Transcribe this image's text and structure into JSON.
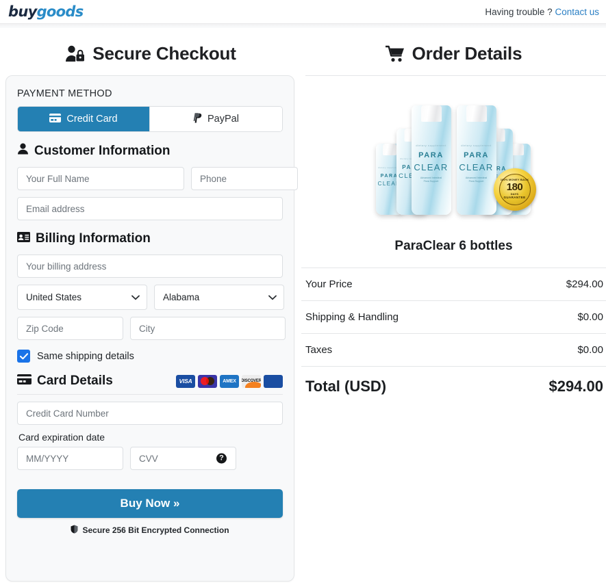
{
  "header": {
    "logo_buy": "buy",
    "logo_goods": "goods",
    "help_text": "Having trouble ?",
    "help_link": "Contact us"
  },
  "left": {
    "title": "Secure Checkout",
    "payment_method_label": "PAYMENT METHOD",
    "tabs": [
      {
        "label": "Credit Card",
        "icon": "credit-card-icon",
        "active": true
      },
      {
        "label": "PayPal",
        "icon": "paypal-icon",
        "active": false
      }
    ],
    "customer": {
      "heading": "Customer Information",
      "full_name_placeholder": "Your Full Name",
      "full_name_value": "",
      "phone_placeholder": "Phone",
      "phone_value": "",
      "email_placeholder": "Email address",
      "email_value": ""
    },
    "billing": {
      "heading": "Billing Information",
      "address_placeholder": "Your billing address",
      "address_value": "",
      "country_selected": "United States",
      "state_selected": "Alabama",
      "zip_placeholder": "Zip Code",
      "zip_value": "",
      "city_placeholder": "City",
      "city_value": "",
      "same_shipping_label": "Same shipping details",
      "same_shipping_checked": true
    },
    "card": {
      "heading": "Card Details",
      "logos": [
        "VISA",
        "Mastercard",
        "AMEX",
        "DISCOVER",
        "JCB"
      ],
      "number_placeholder": "Credit Card Number",
      "number_value": "",
      "expiration_label": "Card expiration date",
      "expiration_placeholder": "MM/YYYY",
      "expiration_value": "",
      "cvv_placeholder": "CVV",
      "cvv_value": "",
      "cvv_help_icon": "question-mark-icon"
    },
    "buy_button": "Buy Now »",
    "secure_note": "Secure 256 Bit Encrypted Connection"
  },
  "right": {
    "title": "Order Details",
    "product_name": "ParaClear 6 bottles",
    "product_label_brand_top": "dietary supplement",
    "product_label_line1": "PARA",
    "product_label_line2": "CLEAR",
    "product_label_sub": "Advanced Intestinal\nFlora Support",
    "badge": {
      "top_text": "100% MONEY BACK",
      "number": "180",
      "days": "DAYS",
      "bottom_text": "GUARANTEE"
    },
    "summary": [
      {
        "label": "Your Price",
        "value": "$294.00"
      },
      {
        "label": "Shipping & Handling",
        "value": "$0.00"
      },
      {
        "label": "Taxes",
        "value": "$0.00"
      }
    ],
    "total": {
      "label": "Total (USD)",
      "value": "$294.00"
    }
  },
  "colors": {
    "accent_blue": "#2480b3",
    "link_blue": "#2a7fc4",
    "checkbox_blue": "#1a73e8",
    "panel_bg": "#f8f9fa"
  }
}
